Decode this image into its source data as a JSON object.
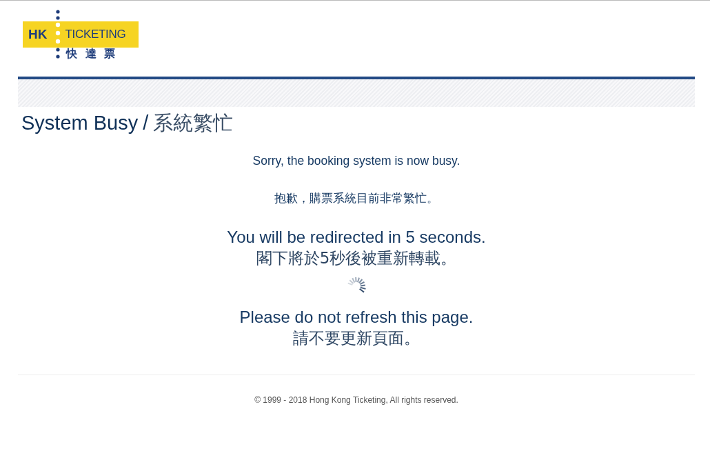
{
  "logo": {
    "brand_left": "HK",
    "brand_right": "TICKETING",
    "brand_chinese": "快 達 票"
  },
  "title": {
    "english": "System Busy",
    "separator": "/",
    "chinese": "系統繁忙"
  },
  "messages": [
    {
      "kind": "small",
      "text": "Sorry, the booking system is now busy."
    },
    {
      "kind": "small",
      "text": "抱歉，購票系統目前非常繁忙。"
    },
    {
      "kind": "large",
      "text": "You will be redirected in 5 seconds."
    },
    {
      "kind": "large-tight",
      "text": "閣下將於5秒後被重新轉載。"
    },
    {
      "kind": "spinner"
    },
    {
      "kind": "large",
      "text": "Please do not refresh this page."
    },
    {
      "kind": "large-tight",
      "text": "請不要更新頁面。"
    }
  ],
  "footer": "© 1999 - 2018 Hong Kong Ticketing, All rights reserved."
}
